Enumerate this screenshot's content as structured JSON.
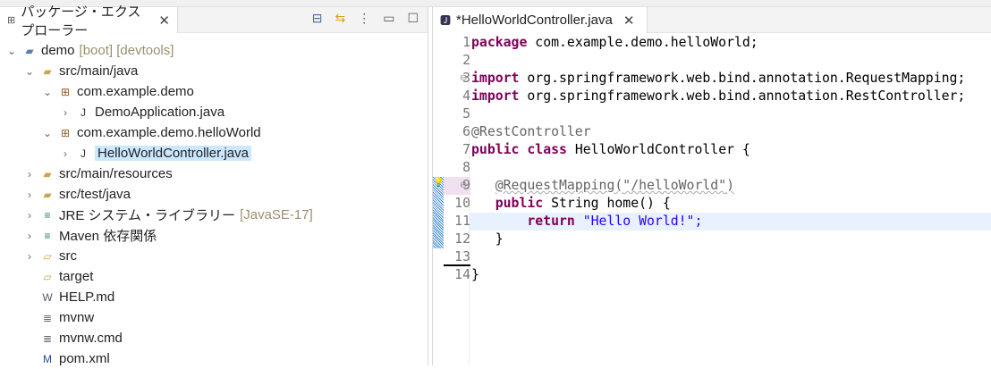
{
  "explorer": {
    "title": "パッケージ・エクスプローラー",
    "tree": [
      {
        "label": "demo",
        "deco": "[boot] [devtools]",
        "depth": 0,
        "chev": "⌄",
        "icon": "project-icon"
      },
      {
        "label": "src/main/java",
        "depth": 1,
        "chev": "⌄",
        "icon": "source-folder-icon"
      },
      {
        "label": "com.example.demo",
        "depth": 2,
        "chev": "⌄",
        "icon": "package-icon"
      },
      {
        "label": "DemoApplication.java",
        "depth": 3,
        "chev": "›",
        "icon": "java-file-icon"
      },
      {
        "label": "com.example.demo.helloWorld",
        "depth": 2,
        "chev": "⌄",
        "icon": "package-icon"
      },
      {
        "label": "HelloWorldController.java",
        "depth": 3,
        "chev": "›",
        "icon": "java-file-icon",
        "selected": true
      },
      {
        "label": "src/main/resources",
        "depth": 1,
        "chev": "›",
        "icon": "source-folder-icon"
      },
      {
        "label": "src/test/java",
        "depth": 1,
        "chev": "›",
        "icon": "source-folder-icon"
      },
      {
        "label": "JRE システム・ライブラリー",
        "deco": "[JavaSE-17]",
        "depth": 1,
        "chev": "›",
        "icon": "library-icon"
      },
      {
        "label": "Maven 依存関係",
        "depth": 1,
        "chev": "›",
        "icon": "library-icon"
      },
      {
        "label": "src",
        "depth": 1,
        "chev": "›",
        "icon": "folder-icon"
      },
      {
        "label": "target",
        "depth": 1,
        "chev": "",
        "icon": "folder-icon"
      },
      {
        "label": "HELP.md",
        "depth": 1,
        "chev": "",
        "icon": "markdown-file-icon"
      },
      {
        "label": "mvnw",
        "depth": 1,
        "chev": "",
        "icon": "text-file-icon"
      },
      {
        "label": "mvnw.cmd",
        "depth": 1,
        "chev": "",
        "icon": "text-file-icon"
      },
      {
        "label": "pom.xml",
        "depth": 1,
        "chev": "",
        "icon": "maven-pom-icon"
      }
    ]
  },
  "editor": {
    "tab": "*HelloWorldController.java",
    "lines": [
      [
        [
          "kw",
          "package"
        ],
        [
          "",
          "com.example.demo.helloWorld;"
        ]
      ],
      [],
      [
        [
          "kw",
          "import"
        ],
        [
          "",
          "org.springframework.web.bind.annotation.RequestMapping;"
        ]
      ],
      [
        [
          "kw",
          "import"
        ],
        [
          "",
          "org.springframework.web.bind.annotation.RestController;"
        ]
      ],
      [],
      [
        [
          "ann0",
          "@RestController"
        ]
      ],
      [
        [
          "kw",
          "public"
        ],
        [
          "kw",
          "class"
        ],
        [
          "",
          "HelloWorldController {"
        ]
      ],
      [],
      [
        [
          "",
          "   "
        ],
        [
          "ann",
          "@RequestMapping(\"/helloWorld\")"
        ]
      ],
      [
        [
          "",
          "   "
        ],
        [
          "kw",
          "public"
        ],
        [
          "",
          "String home() {"
        ]
      ],
      [
        [
          "",
          "       "
        ],
        [
          "kw",
          "return"
        ],
        [
          "str",
          "\"Hello World!\";"
        ]
      ],
      [
        [
          "",
          "   }"
        ]
      ],
      [],
      [
        [
          "",
          "}"
        ]
      ]
    ]
  }
}
